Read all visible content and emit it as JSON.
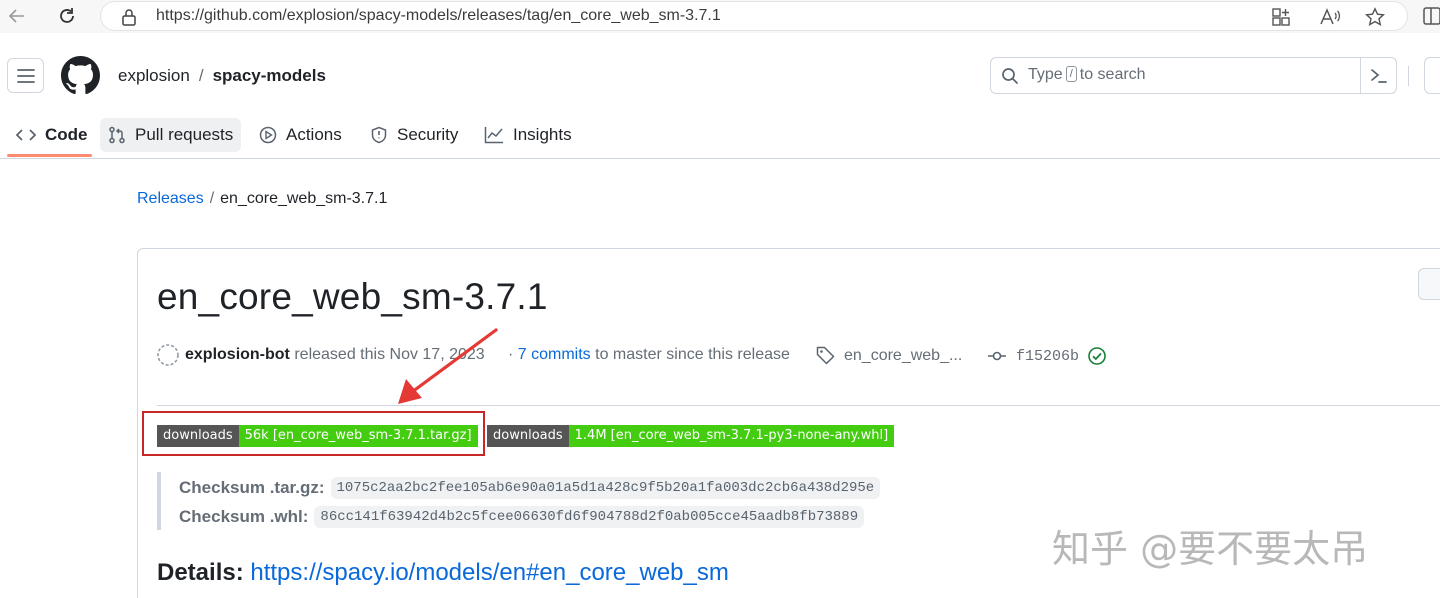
{
  "browser": {
    "url": "https://github.com/explosion/spacy-models/releases/tag/en_core_web_sm-3.7.1"
  },
  "header": {
    "owner": "explosion",
    "separator": "/",
    "repo": "spacy-models",
    "search_prefix": "Type",
    "search_key": "/",
    "search_suffix": "to search"
  },
  "tabs": [
    {
      "label": "Code",
      "icon": "code-icon",
      "selected": true
    },
    {
      "label": "Pull requests",
      "icon": "pull-request-icon"
    },
    {
      "label": "Actions",
      "icon": "play-icon"
    },
    {
      "label": "Security",
      "icon": "shield-icon"
    },
    {
      "label": "Insights",
      "icon": "graph-icon"
    }
  ],
  "breadcrumb": {
    "parent": "Releases",
    "separator": "/",
    "current": "en_core_web_sm-3.7.1"
  },
  "release": {
    "title": "en_core_web_sm-3.7.1",
    "author": "explosion-bot",
    "released_text": "released this Nov 17, 2023",
    "commits_prefix": "·",
    "commits_link": "7 commits",
    "commits_suffix": "to master since this release",
    "tag": "en_core_web_...",
    "commit": "f15206b",
    "badges": [
      {
        "label": "downloads",
        "value": "56k [en_core_web_sm-3.7.1.tar.gz]"
      },
      {
        "label": "downloads",
        "value": "1.4M [en_core_web_sm-3.7.1-py3-none-any.whl]"
      }
    ],
    "checksum_targz_label": "Checksum .tar.gz:",
    "checksum_targz": "1075c2aa2bc2fee105ab6e90a01a5d1a428c9f5b20a1fa003dc2cb6a438d295e",
    "checksum_whl_label": "Checksum .whl:",
    "checksum_whl": "86cc141f63942d4b2c5fcee06630fd6f904788d2f0ab005cce45aadb8fb73889",
    "details_label": "Details:",
    "details_link": "https://spacy.io/models/en#en_core_web_sm"
  },
  "watermark": "知乎 @要不要太吊",
  "colors": {
    "link": "#0969da",
    "badge_green": "#44cc11",
    "badge_gray": "#555555",
    "annotation_red": "#c62828",
    "tab_underline": "#fd8c73"
  }
}
